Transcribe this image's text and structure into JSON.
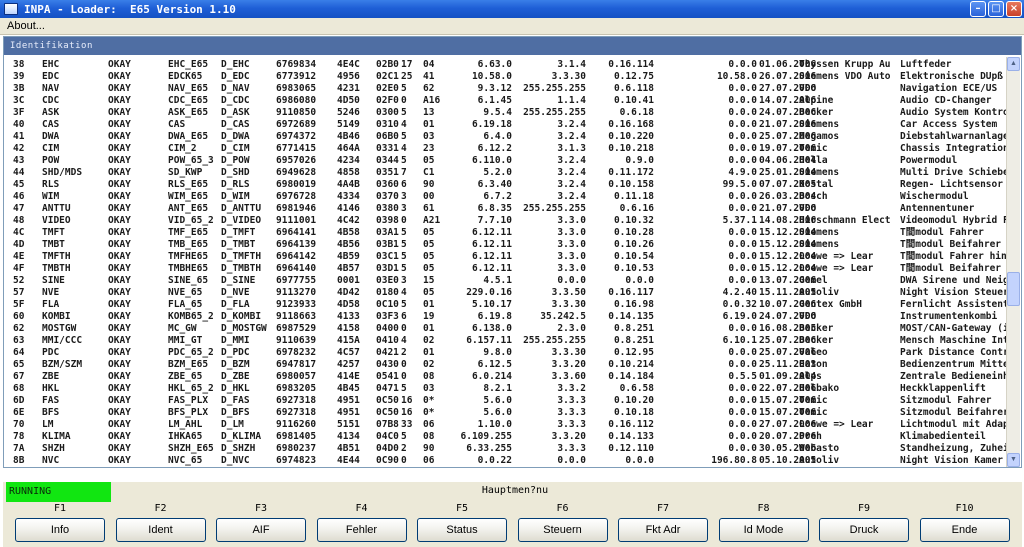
{
  "window": {
    "title": "INPA - Loader:  E65 Version 1.10"
  },
  "menu": {
    "about_label": "About..."
  },
  "panel": {
    "header": "Identifikation"
  },
  "table": {
    "rows": [
      [
        "38",
        "EHC",
        "OKAY",
        "EHC_E65",
        "D_EHC",
        "6769834",
        "4E4C",
        "02B0",
        "17",
        "04",
        "6.63.0",
        "3.1.4",
        "0.16.114",
        "0.0.0",
        "01.06.2006",
        "Thyssen Krupp Au",
        "Luftfeder"
      ],
      [
        "39",
        "EDC",
        "OKAY",
        "EDCK65",
        "D_EDC",
        "6773912",
        "4956",
        "02C1",
        "25",
        "41",
        "10.58.0",
        "3.3.30",
        "0.12.75",
        "10.58.0",
        "26.07.2006",
        "Siemens VDO Auto",
        "Elektronische DÜpß"
      ],
      [
        "3B",
        "NAV",
        "OKAY",
        "NAV_E65",
        "D_NAV",
        "6983065",
        "4231",
        "02E0",
        "5",
        "62",
        "9.3.12",
        "255.255.255",
        "0.6.118",
        "0.0.0",
        "27.07.2006",
        "VDO",
        "Navigation ECE/US"
      ],
      [
        "3C",
        "CDC",
        "OKAY",
        "CDC_E65",
        "D_CDC",
        "6986080",
        "4D50",
        "02F0",
        "0",
        "A16",
        "6.1.45",
        "1.1.4",
        "0.10.41",
        "0.0.0",
        "14.07.2006",
        "Alpine",
        "Audio CD-Changer"
      ],
      [
        "3F",
        "ASK",
        "OKAY",
        "ASK_E65",
        "D_ASK",
        "9110850",
        "5246",
        "0300",
        "5",
        "13",
        "9.5.4",
        "255.255.255",
        "0.6.18",
        "0.0.0",
        "24.07.2006",
        "Becker",
        "Audio System Kontro"
      ],
      [
        "40",
        "CAS",
        "OKAY",
        "CAS",
        "D_CAS",
        "6972689",
        "5149",
        "0310",
        "4",
        "01",
        "6.19.18",
        "3.2.4",
        "0.16.168",
        "0.0.0",
        "21.07.2006",
        "Siemens",
        "Car Access System"
      ],
      [
        "41",
        "DWA",
        "OKAY",
        "DWA_E65",
        "D_DWA",
        "6974372",
        "4B46",
        "06B0",
        "5",
        "03",
        "6.4.0",
        "3.2.4",
        "0.10.220",
        "0.0.0",
        "25.07.2006",
        "Megamos",
        "Diebstahlwarnanlage"
      ],
      [
        "42",
        "CIM",
        "OKAY",
        "CIM_2",
        "D_CIM",
        "6771415",
        "464A",
        "0331",
        "4",
        "23",
        "6.12.2",
        "3.1.3",
        "0.10.218",
        "0.0.0",
        "19.07.2006",
        "Temic",
        "Chassis Integration"
      ],
      [
        "43",
        "POW",
        "OKAY",
        "POW_65_3",
        "D_POW",
        "6957026",
        "4234",
        "0344",
        "5",
        "05",
        "6.110.0",
        "3.2.4",
        "0.9.0",
        "0.0.0",
        "04.06.2004",
        "Hella",
        "Powermodul"
      ],
      [
        "44",
        "SHD/MDS",
        "OKAY",
        "SD_KWP",
        "D_SHD",
        "6949628",
        "4858",
        "0351",
        "7",
        "C1",
        "5.2.0",
        "3.2.4",
        "0.11.172",
        "4.9.0",
        "25.01.2004",
        "Siemens",
        "Multi Drive Schiebe"
      ],
      [
        "45",
        "RLS",
        "OKAY",
        "RLS_E65",
        "D_RLS",
        "6980019",
        "4A4B",
        "0360",
        "6",
        "90",
        "6.3.40",
        "3.2.4",
        "0.10.158",
        "99.5.0",
        "07.07.2005",
        "Kostal",
        "Regen- Lichtsensor"
      ],
      [
        "46",
        "WIM",
        "OKAY",
        "WIM_E65",
        "D_WIM",
        "6976728",
        "4334",
        "0370",
        "3",
        "00",
        "6.7.2",
        "3.2.4",
        "0.11.18",
        "0.0.0",
        "26.03.2004",
        "Bosch",
        "Wischermodul"
      ],
      [
        "47",
        "ANTTU",
        "OKAY",
        "ANT_E65",
        "D_ANTTU",
        "6981946",
        "4146",
        "0380",
        "3",
        "61",
        "6.8.35",
        "255.255.255",
        "0.6.16",
        "0.0.0",
        "21.07.2006",
        "VDO",
        "Antennentuner"
      ],
      [
        "48",
        "VIDEO",
        "OKAY",
        "VID_65_2",
        "D_VIDEO",
        "9111001",
        "4C42",
        "0398",
        "0",
        "A21",
        "7.7.10",
        "3.3.0",
        "0.10.32",
        "5.37.1",
        "14.08.2006",
        "Hirschmann Elect",
        "Videomodul Hybrid F"
      ],
      [
        "4C",
        "TMFT",
        "OKAY",
        "TMF_E65",
        "D_TMFT",
        "6964141",
        "4B58",
        "03A1",
        "5",
        "05",
        "6.12.11",
        "3.3.0",
        "0.10.28",
        "0.0.0",
        "15.12.2004",
        "Siemens",
        "T間modul Fahrer"
      ],
      [
        "4D",
        "TMBT",
        "OKAY",
        "TMB_E65",
        "D_TMBT",
        "6964139",
        "4B56",
        "03B1",
        "5",
        "05",
        "6.12.11",
        "3.3.0",
        "0.10.26",
        "0.0.0",
        "15.12.2004",
        "Siemens",
        "T間modul Beifahrer"
      ],
      [
        "4E",
        "TMFTH",
        "OKAY",
        "TMFHE65",
        "D_TMFTH",
        "6964142",
        "4B59",
        "03C1",
        "5",
        "05",
        "6.12.11",
        "3.3.0",
        "0.10.54",
        "0.0.0",
        "15.12.2004",
        "Loewe => Lear",
        "T間modul Fahrer hin"
      ],
      [
        "4F",
        "TMBTH",
        "OKAY",
        "TMBHE65",
        "D_TMBTH",
        "6964140",
        "4B57",
        "03D1",
        "5",
        "05",
        "6.12.11",
        "3.3.0",
        "0.10.53",
        "0.0.0",
        "15.12.2004",
        "Loewe => Lear",
        "T間modul Beifahrer"
      ],
      [
        "52",
        "SINE",
        "OKAY",
        "SINE_65",
        "D_SINE",
        "6977755",
        "0001",
        "03E0",
        "3",
        "15",
        "4.5.1",
        "0.0.0",
        "0.0.0",
        "0.0.0",
        "13.07.2006",
        "Gemel",
        "DWA Sirene und Neig"
      ],
      [
        "57",
        "NVE",
        "OKAY",
        "NVE_65",
        "D_NVE",
        "9113270",
        "4D42",
        "0180",
        "4",
        "05",
        "229.0.16",
        "3.3.50",
        "0.16.117",
        "4.2.40",
        "15.11.2005",
        "Autoliv",
        "Night Vision Steuer"
      ],
      [
        "5F",
        "FLA",
        "OKAY",
        "FLA_65",
        "D_FLA",
        "9123933",
        "4D58",
        "0C10",
        "5",
        "01",
        "5.10.17",
        "3.3.30",
        "0.16.98",
        "0.0.32",
        "10.07.2006",
        "Gentex GmbH",
        "Fernlicht Assistent"
      ],
      [
        "60",
        "KOMBI",
        "OKAY",
        "KOMB65_2",
        "D_KOMBI",
        "9118663",
        "4133",
        "03F3",
        "6",
        "19",
        "6.19.8",
        "35.242.5",
        "0.14.135",
        "6.19.0",
        "24.07.2006",
        "VDO",
        "Instrumentenkombi"
      ],
      [
        "62",
        "MOSTGW",
        "OKAY",
        "MC_GW",
        "D_MOSTGW",
        "6987529",
        "4158",
        "0400",
        "0",
        "01",
        "6.138.0",
        "2.3.0",
        "0.8.251",
        "0.0.0",
        "16.08.2005",
        "Becker",
        "MOST/CAN-Gateway (i"
      ],
      [
        "63",
        "MMI/CCC",
        "OKAY",
        "MMI_GT",
        "D_MMI",
        "9110639",
        "415A",
        "0410",
        "4",
        "02",
        "6.157.11",
        "255.255.255",
        "0.8.251",
        "6.10.1",
        "25.07.2006",
        "Becker",
        "Mensch Maschine Int"
      ],
      [
        "64",
        "PDC",
        "OKAY",
        "PDC_65_2",
        "D_PDC",
        "6978232",
        "4C57",
        "0421",
        "2",
        "01",
        "9.8.0",
        "3.3.30",
        "0.12.95",
        "0.0.0",
        "25.07.2006",
        "Valeo",
        "Park Distance Contr"
      ],
      [
        "65",
        "BZM/SZM",
        "OKAY",
        "BZM_E65",
        "D_BZM",
        "6947817",
        "4257",
        "0430",
        "0",
        "02",
        "6.12.5",
        "3.3.20",
        "0.10.214",
        "0.0.0",
        "25.11.2003",
        "Eaton",
        "Bedienzentrum Mitte"
      ],
      [
        "67",
        "ZBE",
        "OKAY",
        "ZBE_65",
        "D_ZBE",
        "6980057",
        "414E",
        "0541",
        "0",
        "08",
        "6.0.214",
        "3.3.60",
        "0.14.184",
        "0.5.5",
        "01.09.2004",
        "Alps",
        "Zentrale Bedieneinh"
      ],
      [
        "68",
        "HKL",
        "OKAY",
        "HKL_65_2",
        "D_HKL",
        "6983205",
        "4B45",
        "0471",
        "5",
        "03",
        "8.2.1",
        "3.3.2",
        "0.6.58",
        "0.0.0",
        "22.07.2006",
        "Helbako",
        "Heckklappenlift"
      ],
      [
        "6D",
        "FAS",
        "OKAY",
        "FAS_PLX",
        "D_FAS",
        "6927318",
        "4951",
        "0C50",
        "16",
        "0*",
        "5.6.0",
        "3.3.3",
        "0.10.20",
        "0.0.0",
        "15.07.2006",
        "Temic",
        "Sitzmodul Fahrer"
      ],
      [
        "6E",
        "BFS",
        "OKAY",
        "BFS_PLX",
        "D_BFS",
        "6927318",
        "4951",
        "0C50",
        "16",
        "0*",
        "5.6.0",
        "3.3.3",
        "0.10.18",
        "0.0.0",
        "15.07.2006",
        "Temic",
        "Sitzmodul Beifahrer"
      ],
      [
        "70",
        "LM",
        "OKAY",
        "LM_AHL",
        "D_LM",
        "9116260",
        "5151",
        "07B8",
        "33",
        "06",
        "1.10.0",
        "3.3.3",
        "0.16.112",
        "0.0.0",
        "27.07.2006",
        "Loewe => Lear",
        "Lichtmodul mit Adap"
      ],
      [
        "78",
        "KLIMA",
        "OKAY",
        "IHKA65",
        "D_KLIMA",
        "6981405",
        "4134",
        "04C0",
        "5",
        "08",
        "6.109.255",
        "3.3.20",
        "0.14.133",
        "0.0.0",
        "20.07.2006",
        "Preh",
        "Klimabedienteil"
      ],
      [
        "7A",
        "SHZH",
        "OKAY",
        "SHZH_E65",
        "D_SHZH",
        "6980237",
        "4B51",
        "04D0",
        "2",
        "90",
        "6.33.255",
        "3.3.3",
        "0.12.110",
        "0.0.0",
        "30.05.2006",
        "Webasto",
        "Standheizung, Zuhei"
      ],
      [
        "8B",
        "NVC",
        "OKAY",
        "NVC_65",
        "D_NVC",
        "6974823",
        "4E44",
        "0C90",
        "0",
        "06",
        "0.0.22",
        "0.0.0",
        "0.0.0",
        "196.80.8",
        "05.10.2005",
        "Autoliv",
        "Night Vision Kamer"
      ]
    ]
  },
  "status": {
    "indicator": "RUNNING",
    "menu_name": "Hauptmen?nu",
    "indicator_color": "#11e611"
  },
  "fkeys": [
    {
      "key": "F1",
      "label": "Info"
    },
    {
      "key": "F2",
      "label": "Ident"
    },
    {
      "key": "F3",
      "label": "AIF"
    },
    {
      "key": "F4",
      "label": "Fehler"
    },
    {
      "key": "F5",
      "label": "Status"
    },
    {
      "key": "F6",
      "label": "Steuern"
    },
    {
      "key": "F7",
      "label": "Fkt Adr"
    },
    {
      "key": "F8",
      "label": "Id Mode"
    },
    {
      "key": "F9",
      "label": "Druck"
    },
    {
      "key": "F10",
      "label": "Ende"
    }
  ],
  "icons": [
    "app-icon",
    "minimize-icon",
    "maximize-icon",
    "close-icon",
    "scroll-up-icon",
    "scroll-down-icon"
  ],
  "colors": {
    "titlebar": "#1f5fd6",
    "panel_header": "#4f6ea3",
    "status_green": "#11e611"
  }
}
